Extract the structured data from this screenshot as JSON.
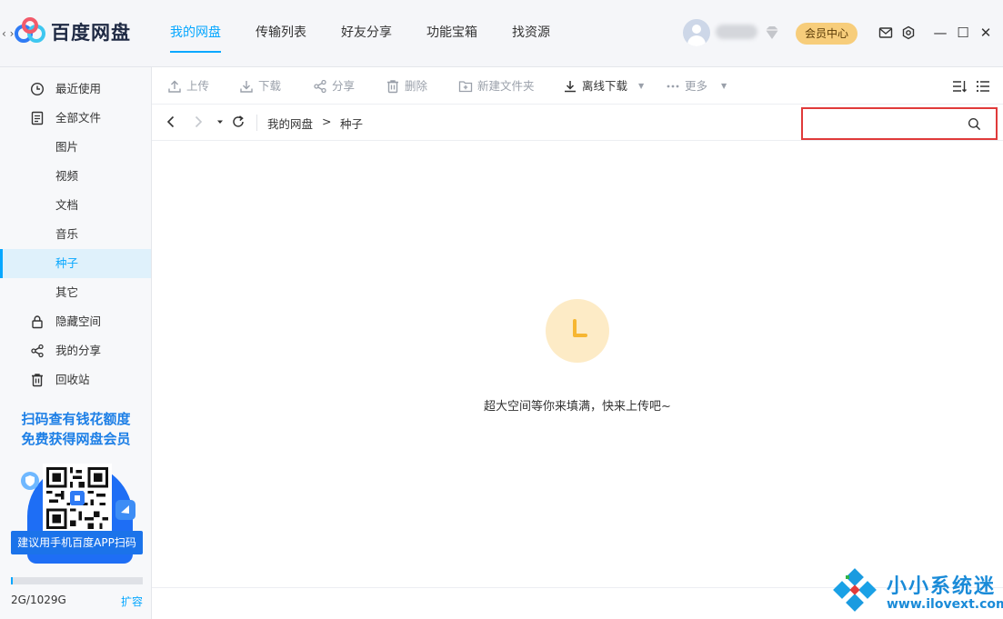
{
  "app": {
    "name": "百度网盘",
    "back_glyph": "‹ ›"
  },
  "nav": {
    "items": [
      {
        "label": "我的网盘",
        "active": true
      },
      {
        "label": "传输列表"
      },
      {
        "label": "好友分享"
      },
      {
        "label": "功能宝箱"
      },
      {
        "label": "找资源"
      }
    ]
  },
  "header": {
    "vip_label": "会员中心",
    "minimize": "—",
    "maximize": "☐",
    "close": "✕"
  },
  "sidebar": {
    "items": [
      {
        "label": "最近使用",
        "icon": "clock-icon"
      },
      {
        "label": "全部文件",
        "icon": "file-icon"
      },
      {
        "label": "图片"
      },
      {
        "label": "视频"
      },
      {
        "label": "文档"
      },
      {
        "label": "音乐"
      },
      {
        "label": "种子",
        "active": true
      },
      {
        "label": "其它"
      },
      {
        "label": "隐藏空间",
        "icon": "lock-icon"
      },
      {
        "label": "我的分享",
        "icon": "share-icon"
      },
      {
        "label": "回收站",
        "icon": "trash-icon"
      }
    ],
    "promo_line1": "扫码查有钱花额度",
    "promo_line2": "免费获得网盘会员",
    "scan_button": "建议用手机百度APP扫码",
    "storage_text": "2G/1029G",
    "storage_used_fraction": 0.0019,
    "expand_label": "扩容"
  },
  "toolbar": {
    "upload": "上传",
    "download": "下载",
    "share": "分享",
    "delete": "删除",
    "new_folder": "新建文件夹",
    "offline_download": "离线下载",
    "more": "更多"
  },
  "address": {
    "crumb_root": "我的网盘",
    "crumb_sep": ">",
    "crumb_current": "种子",
    "search_value": "",
    "search_placeholder": ""
  },
  "empty": {
    "message": "超大空间等你来填满，快来上传吧~"
  },
  "watermark": {
    "title": "小小系统迷",
    "url": "www.ilovext.com"
  },
  "colors": {
    "accent": "#06a7ff",
    "vip": "#f7cd7b",
    "highlight_border": "#e03a3a"
  }
}
